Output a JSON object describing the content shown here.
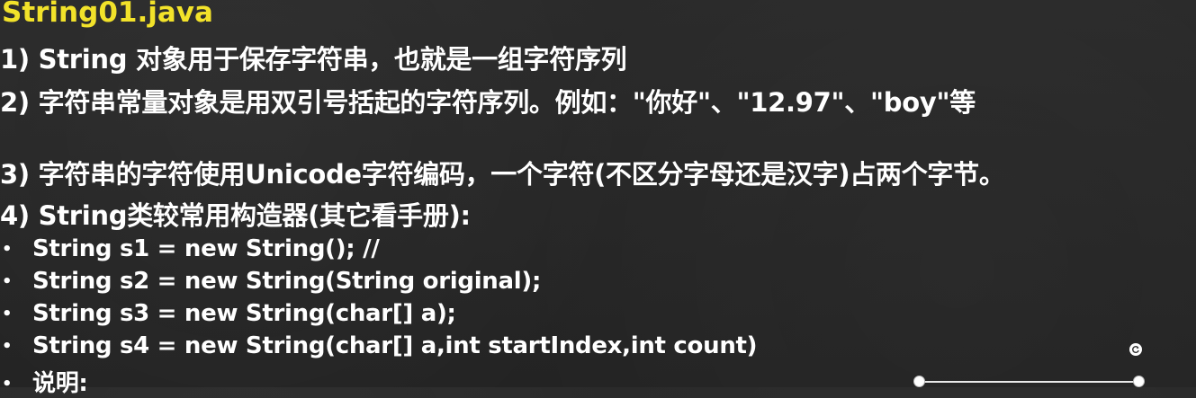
{
  "title": "String01.java",
  "lines": [
    "1) String 对象用于保存字符串，也就是一组字符序列",
    "2) 字符串常量对象是用双引号括起的字符序列。例如：\"你好\"、\"12.97\"、\"boy\"等",
    "3) 字符串的字符使用Unicode字符编码，一个字符(不区分字母还是汉字)占两个字节。",
    "4) String类较常用构造器(其它看手册):"
  ],
  "bullet_symbol": "•",
  "bullets": [
    "String  s1 = new String(); //",
    "String  s2 = new String(String original);",
    "String  s3 = new String(char[] a);",
    "String  s4 =  new String(char[] a,int startIndex,int count)",
    "说明:"
  ],
  "colors": {
    "title": "#f2e22a",
    "text": "#ffffff",
    "background": "#262626"
  },
  "icons": {
    "rotate_handle": "rotate-icon",
    "selection_handles": "selection-handle"
  }
}
